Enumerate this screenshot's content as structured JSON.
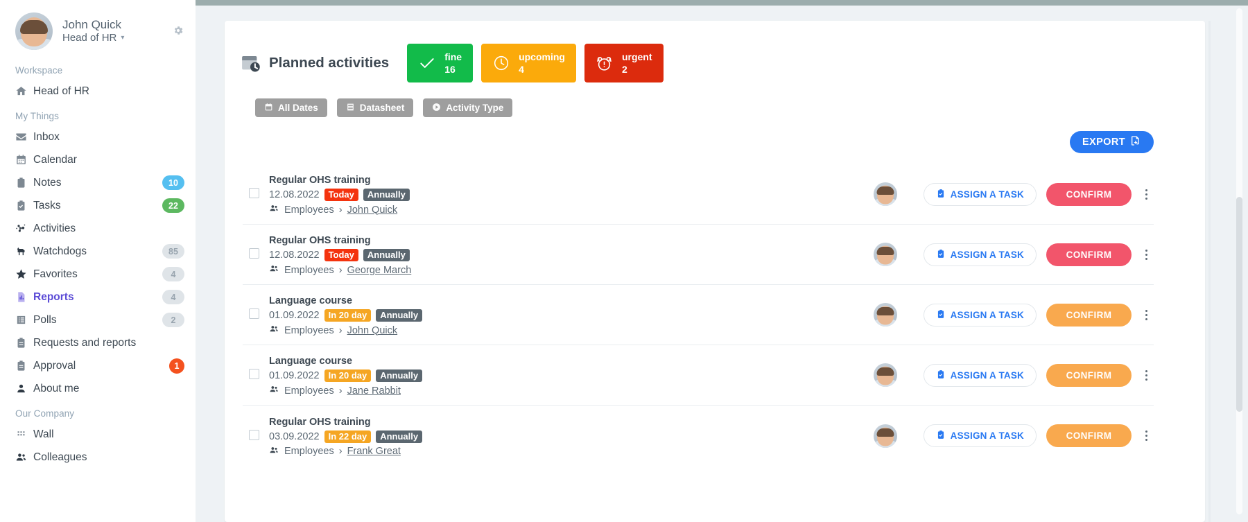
{
  "sidebar": {
    "profile": {
      "name": "John Quick",
      "role": "Head of HR",
      "caret": "▾",
      "gear_icon": "gear-icon"
    },
    "sections": [
      {
        "label": "Workspace",
        "items": [
          {
            "label": "Head of HR",
            "icon": "home-icon",
            "badge": null,
            "active": false
          }
        ]
      },
      {
        "label": "My Things",
        "items": [
          {
            "label": "Inbox",
            "icon": "envelope-icon",
            "badge": null,
            "badge_style": null,
            "active": false
          },
          {
            "label": "Calendar",
            "icon": "calendar-icon",
            "badge": null,
            "badge_style": null,
            "active": false
          },
          {
            "label": "Notes",
            "icon": "note-icon",
            "badge": "10",
            "badge_style": "blue",
            "active": false
          },
          {
            "label": "Tasks",
            "icon": "task-icon",
            "badge": "22",
            "badge_style": "green",
            "active": false
          },
          {
            "label": "Activities",
            "icon": "activities-icon",
            "badge": null,
            "badge_style": null,
            "active": false
          },
          {
            "label": "Watchdogs",
            "icon": "dog-icon",
            "badge": "85",
            "badge_style": "gray",
            "active": false
          },
          {
            "label": "Favorites",
            "icon": "star-icon",
            "badge": "4",
            "badge_style": "gray",
            "active": false
          },
          {
            "label": "Reports",
            "icon": "report-chart-icon",
            "badge": "4",
            "badge_style": "gray",
            "active": true
          },
          {
            "label": "Polls",
            "icon": "poll-list-icon",
            "badge": "2",
            "badge_style": "gray",
            "active": false
          },
          {
            "label": "Requests and reports",
            "icon": "clipboard-icon",
            "badge": null,
            "badge_style": null,
            "active": false
          },
          {
            "label": "Approval",
            "icon": "clipboard-icon",
            "badge": "1",
            "badge_style": "red",
            "active": false
          },
          {
            "label": "About me",
            "icon": "person-icon",
            "badge": null,
            "badge_style": null,
            "active": false
          }
        ]
      },
      {
        "label": "Our Company",
        "items": [
          {
            "label": "Wall",
            "icon": "grid-dots-icon",
            "badge": null,
            "badge_style": null,
            "active": false
          },
          {
            "label": "Colleagues",
            "icon": "people-icon",
            "badge": null,
            "badge_style": null,
            "active": false
          }
        ]
      }
    ]
  },
  "header": {
    "title": "Planned activities",
    "title_icon": "calendar-clock-icon",
    "stats": [
      {
        "label": "fine",
        "count": "16",
        "color": "#12bb4a",
        "icon": "check-icon"
      },
      {
        "label": "upcoming",
        "count": "4",
        "color": "#fbaa0b",
        "icon": "clock-icon"
      },
      {
        "label": "urgent",
        "count": "2",
        "color": "#dc2b0d",
        "icon": "alarm-icon"
      }
    ]
  },
  "filters": [
    {
      "label": "All Dates",
      "icon": "calendar-icon"
    },
    {
      "label": "Datasheet",
      "icon": "datasheet-icon"
    },
    {
      "label": "Activity Type",
      "icon": "play-circle-icon"
    }
  ],
  "export": {
    "label": "EXPORT",
    "icon": "export-file-icon",
    "color": "#2979f2"
  },
  "list": {
    "assign_label": "ASSIGN A TASK",
    "confirm_label": "CONFIRM",
    "group_label": "Employees",
    "separator": "›",
    "rows": [
      {
        "title": "Regular OHS training",
        "date": "12.08.2022",
        "status_pill": "Today",
        "status_pill_type": "today",
        "freq_pill": "Annually",
        "group": "Employees",
        "person": "John Quick",
        "confirm_color": "#f2556b"
      },
      {
        "title": "Regular OHS training",
        "date": "12.08.2022",
        "status_pill": "Today",
        "status_pill_type": "today",
        "freq_pill": "Annually",
        "group": "Employees",
        "person": "George March",
        "confirm_color": "#f2556b"
      },
      {
        "title": "Language course",
        "date": "01.09.2022",
        "status_pill": "In 20 day",
        "status_pill_type": "soon",
        "freq_pill": "Annually",
        "group": "Employees",
        "person": "John Quick",
        "confirm_color": "#f9a94e"
      },
      {
        "title": "Language course",
        "date": "01.09.2022",
        "status_pill": "In 20 day",
        "status_pill_type": "soon",
        "freq_pill": "Annually",
        "group": "Employees",
        "person": "Jane Rabbit",
        "confirm_color": "#f9a94e"
      },
      {
        "title": "Regular OHS training",
        "date": "03.09.2022",
        "status_pill": "In 22 day",
        "status_pill_type": "soon",
        "freq_pill": "Annually",
        "group": "Employees",
        "person": "Frank Great",
        "confirm_color": "#f9a94e"
      }
    ]
  }
}
